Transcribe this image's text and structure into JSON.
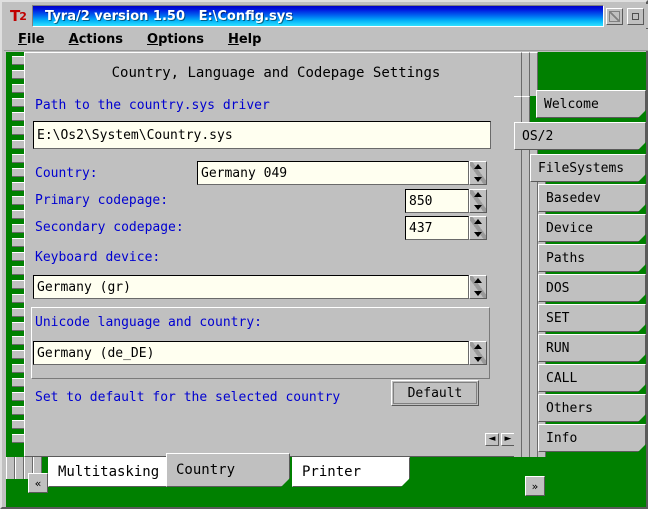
{
  "window": {
    "icon_main": "T",
    "icon_sup": "2",
    "title": "Tyra/2 version 1.50   E:\\Config.sys",
    "hide_button": "hide-button",
    "maximize_button": "maximize-button"
  },
  "menubar": {
    "items": [
      {
        "mnemonic": "F",
        "rest": "ile"
      },
      {
        "mnemonic": "A",
        "rest": "ctions"
      },
      {
        "mnemonic": "O",
        "rest": "ptions"
      },
      {
        "mnemonic": "H",
        "rest": "elp"
      }
    ]
  },
  "page": {
    "title": "Country, Language and Codepage Settings",
    "path_label": "Path to the country.sys driver",
    "path_value": "E:\\Os2\\System\\Country.sys",
    "country_label": "Country:",
    "country_value": "Germany 049",
    "primary_cp_label": "Primary codepage:",
    "primary_cp_value": "850",
    "secondary_cp_label": "Secondary codepage:",
    "secondary_cp_value": "437",
    "keyboard_label": "Keyboard device:",
    "keyboard_value": "Germany (gr)",
    "unicode_label": "Unicode language and country:",
    "unicode_value": "Germany (de_DE)",
    "default_hint": "Set to default for the selected country",
    "default_button": "Default",
    "scroll_left": "◄",
    "scroll_right": "►"
  },
  "right_tabs": {
    "selected": "OS/2",
    "items": [
      {
        "label": "Welcome"
      },
      {
        "label": "OS/2"
      },
      {
        "label": "FileSystems"
      },
      {
        "label": "Basedev"
      },
      {
        "label": "Device"
      },
      {
        "label": "Paths"
      },
      {
        "label": "DOS"
      },
      {
        "label": "SET"
      },
      {
        "label": "RUN"
      },
      {
        "label": "CALL"
      },
      {
        "label": "Others"
      },
      {
        "label": "Info"
      }
    ]
  },
  "bottom_tabs": {
    "selected": "Country",
    "items": [
      {
        "label": "Multitasking"
      },
      {
        "label": "Country"
      },
      {
        "label": "Printer"
      }
    ],
    "scroll_prev": "«",
    "scroll_next": "»"
  },
  "colors": {
    "desktop_green": "#008000",
    "face_grey": "#c0c0c0",
    "label_blue": "#0000d0",
    "entry_bg": "#fffff0",
    "title_grad_top": "#0000c8",
    "title_grad_bottom": "#30e0ff",
    "icon_red": "#c00000"
  }
}
